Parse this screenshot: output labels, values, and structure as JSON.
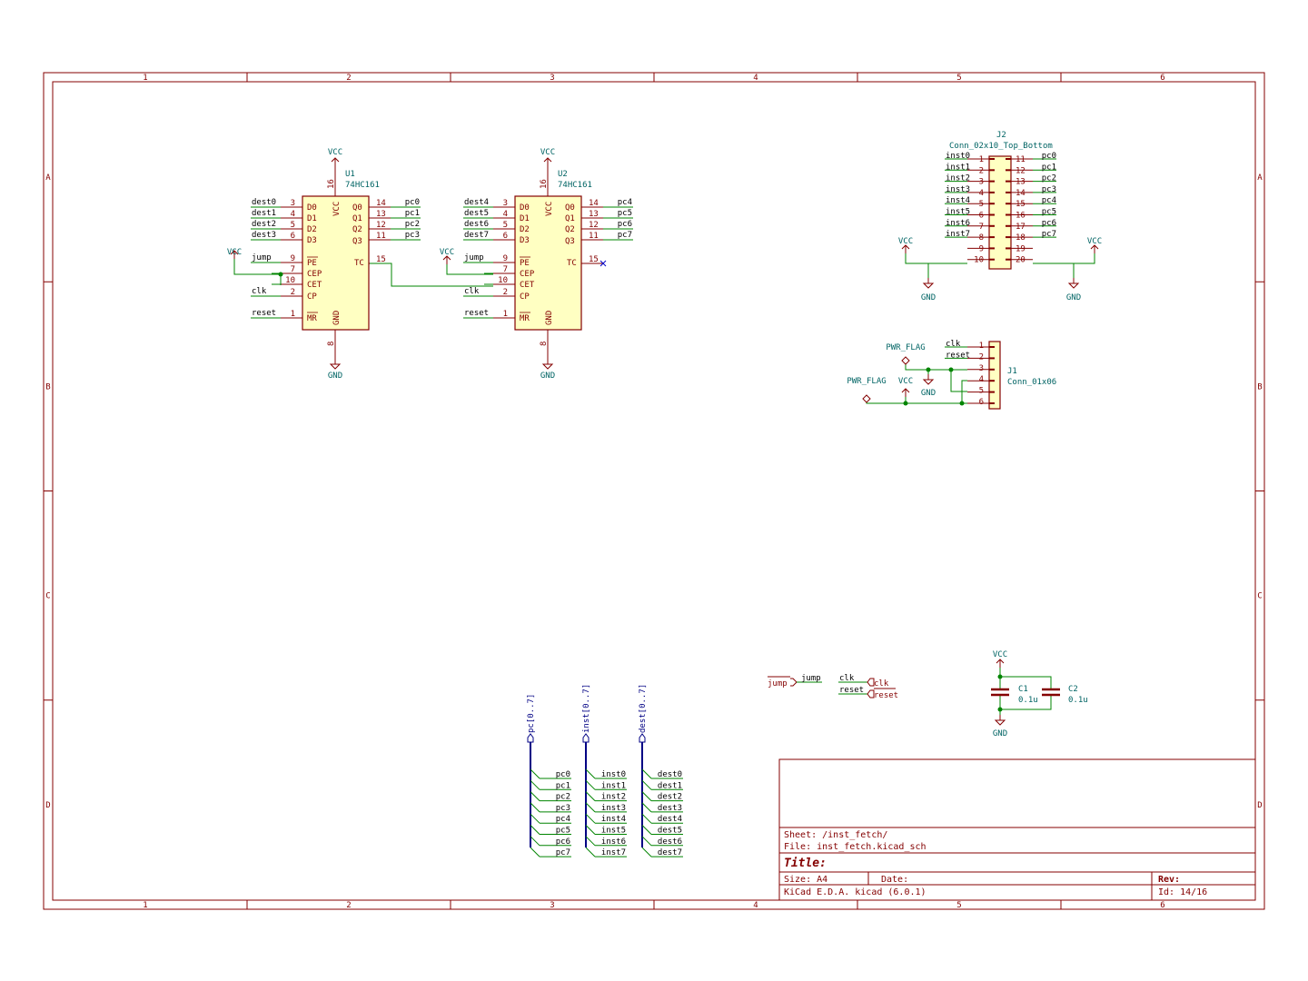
{
  "frame": {
    "columns": [
      "1",
      "2",
      "3",
      "4",
      "5",
      "6"
    ],
    "rows": [
      "A",
      "B",
      "C",
      "D"
    ]
  },
  "title_block": {
    "sheet_label": "Sheet: /inst_fetch/",
    "file_label": "File: inst_fetch.kicad_sch",
    "title_label": "Title:",
    "size_label": "Size: A4",
    "date_label": "Date:",
    "rev_label": "Rev:",
    "tool_label": "KiCad E.D.A.  kicad (6.0.1)",
    "id_label": "Id: 14/16"
  },
  "power": {
    "vcc": "VCC",
    "gnd": "GND",
    "pwr_flag": "PWR_FLAG"
  },
  "u1": {
    "ref": "U1",
    "value": "74HC161",
    "vcc_pin": "16",
    "gnd_pin": "8",
    "pin_names": {
      "D0": "D0",
      "D1": "D1",
      "D2": "D2",
      "D3": "D3",
      "PE": "PE",
      "CEP": "CEP",
      "CET": "CET",
      "CP": "CP",
      "MR": "MR",
      "Q0": "Q0",
      "Q1": "Q1",
      "Q2": "Q2",
      "Q3": "Q3",
      "TC": "TC",
      "VCC": "VCC",
      "GND": "GND"
    },
    "left": [
      {
        "num": "3",
        "net": "dest0"
      },
      {
        "num": "4",
        "net": "dest1"
      },
      {
        "num": "5",
        "net": "dest2"
      },
      {
        "num": "6",
        "net": "dest3"
      },
      {
        "num": "9",
        "net": "jump"
      },
      {
        "num": "7",
        "net": ""
      },
      {
        "num": "10",
        "net": ""
      },
      {
        "num": "2",
        "net": "clk"
      },
      {
        "num": "1",
        "net": "reset"
      }
    ],
    "right": [
      {
        "num": "14",
        "net": "pc0"
      },
      {
        "num": "13",
        "net": "pc1"
      },
      {
        "num": "12",
        "net": "pc2"
      },
      {
        "num": "11",
        "net": "pc3"
      },
      {
        "num": "15",
        "net": ""
      }
    ]
  },
  "u2": {
    "ref": "U2",
    "value": "74HC161",
    "vcc_pin": "16",
    "gnd_pin": "8",
    "left": [
      {
        "num": "3",
        "net": "dest4"
      },
      {
        "num": "4",
        "net": "dest5"
      },
      {
        "num": "5",
        "net": "dest6"
      },
      {
        "num": "6",
        "net": "dest7"
      },
      {
        "num": "9",
        "net": "jump"
      },
      {
        "num": "7",
        "net": ""
      },
      {
        "num": "10",
        "net": ""
      },
      {
        "num": "2",
        "net": "clk"
      },
      {
        "num": "1",
        "net": "reset"
      }
    ],
    "right": [
      {
        "num": "14",
        "net": "pc4"
      },
      {
        "num": "13",
        "net": "pc5"
      },
      {
        "num": "12",
        "net": "pc6"
      },
      {
        "num": "11",
        "net": "pc7"
      },
      {
        "num": "15",
        "net": ""
      }
    ]
  },
  "j2": {
    "ref": "J2",
    "value": "Conn_02x10_Top_Bottom",
    "left": [
      {
        "num": "1",
        "net": "inst0"
      },
      {
        "num": "2",
        "net": "inst1"
      },
      {
        "num": "3",
        "net": "inst2"
      },
      {
        "num": "4",
        "net": "inst3"
      },
      {
        "num": "5",
        "net": "inst4"
      },
      {
        "num": "6",
        "net": "inst5"
      },
      {
        "num": "7",
        "net": "inst6"
      },
      {
        "num": "8",
        "net": "inst7"
      },
      {
        "num": "9",
        "net": ""
      },
      {
        "num": "10",
        "net": ""
      }
    ],
    "right": [
      {
        "num": "11",
        "net": "pc0"
      },
      {
        "num": "12",
        "net": "pc1"
      },
      {
        "num": "13",
        "net": "pc2"
      },
      {
        "num": "14",
        "net": "pc3"
      },
      {
        "num": "15",
        "net": "pc4"
      },
      {
        "num": "16",
        "net": "pc5"
      },
      {
        "num": "17",
        "net": "pc6"
      },
      {
        "num": "18",
        "net": "pc7"
      },
      {
        "num": "19",
        "net": ""
      },
      {
        "num": "20",
        "net": ""
      }
    ]
  },
  "j1": {
    "ref": "J1",
    "value": "Conn_01x06",
    "pins": [
      {
        "num": "1",
        "net": "clk"
      },
      {
        "num": "2",
        "net": "reset"
      },
      {
        "num": "3",
        "net": ""
      },
      {
        "num": "4",
        "net": ""
      },
      {
        "num": "5",
        "net": ""
      },
      {
        "num": "6",
        "net": ""
      }
    ]
  },
  "caps": [
    {
      "ref": "C1",
      "value": "0.1u"
    },
    {
      "ref": "C2",
      "value": "0.1u"
    }
  ],
  "hier_labels": {
    "jump_in": "jump",
    "jump_net": "jump",
    "clk_net": "clk",
    "clk_out": "clk",
    "reset_net": "reset",
    "reset_out": "reset"
  },
  "buses": [
    {
      "label": "pc[0..7]",
      "entries": [
        "pc0",
        "pc1",
        "pc2",
        "pc3",
        "pc4",
        "pc5",
        "pc6",
        "pc7"
      ]
    },
    {
      "label": "inst[0..7]",
      "entries": [
        "inst0",
        "inst1",
        "inst2",
        "inst3",
        "inst4",
        "inst5",
        "inst6",
        "inst7"
      ]
    },
    {
      "label": "dest[0..7]",
      "entries": [
        "dest0",
        "dest1",
        "dest2",
        "dest3",
        "dest4",
        "dest5",
        "dest6",
        "dest7"
      ]
    }
  ]
}
